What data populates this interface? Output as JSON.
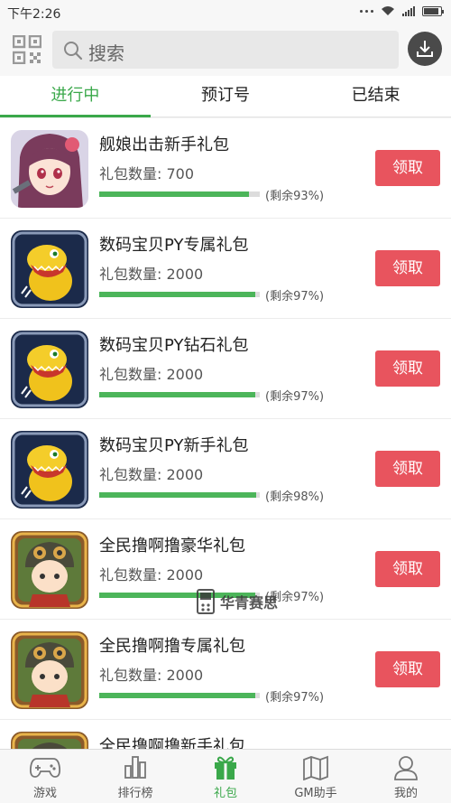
{
  "status_bar": {
    "time": "下午2:26"
  },
  "search": {
    "placeholder": "搜索"
  },
  "tabs": [
    {
      "label": "进行中",
      "active": true
    },
    {
      "label": "预订号",
      "active": false
    },
    {
      "label": "已结束",
      "active": false
    }
  ],
  "gifts": [
    {
      "title": "舰娘出击新手礼包",
      "count": "礼包数量: 700",
      "remain": "(剩余93%)",
      "progress": 0.93,
      "button": "领取",
      "icon": "anime-girl-avatar"
    },
    {
      "title": "数码宝贝PY专属礼包",
      "count": "礼包数量: 2000",
      "remain": "(剩余97%)",
      "progress": 0.97,
      "button": "领取",
      "icon": "agumon-avatar"
    },
    {
      "title": "数码宝贝PY钻石礼包",
      "count": "礼包数量: 2000",
      "remain": "(剩余97%)",
      "progress": 0.97,
      "button": "领取",
      "icon": "agumon-avatar"
    },
    {
      "title": "数码宝贝PY新手礼包",
      "count": "礼包数量: 2000",
      "remain": "(剩余98%)",
      "progress": 0.98,
      "button": "领取",
      "icon": "agumon-avatar"
    },
    {
      "title": "全民撸啊撸豪华礼包",
      "count": "礼包数量: 2000",
      "remain": "(剩余97%)",
      "progress": 0.97,
      "button": "领取",
      "icon": "helmet-warrior-avatar"
    },
    {
      "title": "全民撸啊撸专属礼包",
      "count": "礼包数量: 2000",
      "remain": "(剩余97%)",
      "progress": 0.97,
      "button": "领取",
      "icon": "helmet-warrior-avatar"
    },
    {
      "title": "全民撸啊撸新手礼包",
      "count": "",
      "remain": "",
      "progress": 0,
      "button": "",
      "icon": "helmet-warrior-avatar"
    }
  ],
  "watermark": "华青赛思",
  "bottom_nav": [
    {
      "label": "游戏",
      "icon": "gamepad-icon",
      "active": false
    },
    {
      "label": "排行榜",
      "icon": "bar-chart-icon",
      "active": false
    },
    {
      "label": "礼包",
      "icon": "gift-icon",
      "active": true
    },
    {
      "label": "GM助手",
      "icon": "map-icon",
      "active": false
    },
    {
      "label": "我的",
      "icon": "user-icon",
      "active": false
    }
  ],
  "colors": {
    "accent": "#3aa84a",
    "claim": "#e8545e",
    "progress": "#4cb55a"
  }
}
